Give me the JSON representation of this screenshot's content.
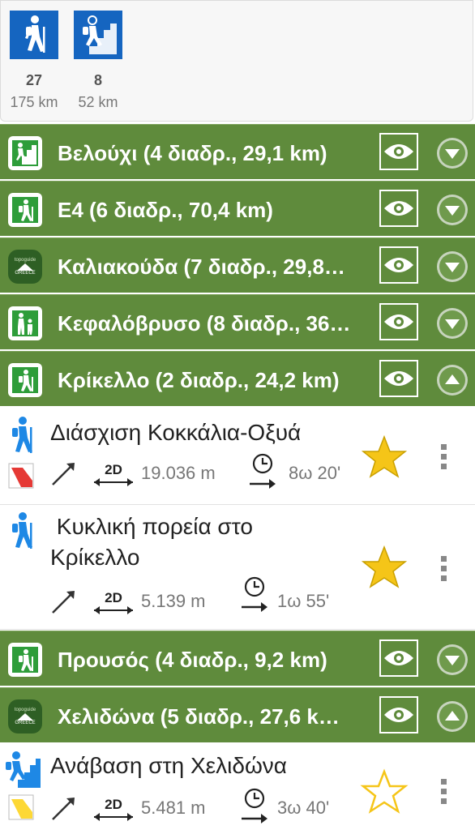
{
  "summary": {
    "stats": [
      {
        "icon": "hiking-icon",
        "count": "27",
        "distance": "175 km"
      },
      {
        "icon": "climbing-icon",
        "count": "8",
        "distance": "52 km"
      }
    ]
  },
  "colors": {
    "group_bg": "#5f8b3c",
    "tile_blue": "#1565c0",
    "hiker_blue": "#1e88e5",
    "star_yellow": "#f5c518"
  },
  "groups": [
    {
      "title": "Βελούχι (4 διαδρ., 29,1 km)",
      "icon": "climbing-icon",
      "expanded": false
    },
    {
      "title": "E4 (6 διαδρ., 70,4 km)",
      "icon": "hiking-icon",
      "expanded": false
    },
    {
      "title": "Καλιακούδα (7 διαδρ., 29,8…",
      "icon": "topoguide-greece-logo",
      "logo_line1": "topoguide",
      "logo_line2": "GREECE",
      "expanded": false
    },
    {
      "title": "Κεφαλόβρυσο (8 διαδρ., 36…",
      "icon": "family-walk-icon",
      "expanded": false
    },
    {
      "title": "Κρίκελλο (2 διαδρ., 24,2 km)",
      "icon": "hiking-icon",
      "expanded": true
    },
    {
      "title": "Προυσός (4 διαδρ., 9,2 km)",
      "icon": "hiking-icon",
      "expanded": false
    },
    {
      "title": "Χελιδώνα (5 διαδρ., 27,6 k…",
      "icon": "topoguide-greece-logo",
      "logo_line1": "topoguide",
      "logo_line2": "GREECE",
      "expanded": true
    }
  ],
  "routes": [
    {
      "title": "Διάσχιση Κοκκάλια-Οξυά",
      "distance": "19.036 m",
      "duration": "8ω 20'",
      "mode_label": "2D",
      "favorite": true,
      "difficulty_color": "#e53935"
    },
    {
      "title": "Κυκλική πορεία στο Κρίκελλο",
      "title_line1": " Κυκλική πορεία στο",
      "title_line2": "Κρίκελλο",
      "distance": "5.139 m",
      "duration": "1ω 55'",
      "mode_label": "2D",
      "favorite": true
    },
    {
      "title": "Ανάβαση στη Χελιδώνα",
      "distance": "5.481 m",
      "duration": "3ω 40'",
      "mode_label": "2D",
      "favorite": false,
      "difficulty_color": "#fdd835"
    }
  ]
}
